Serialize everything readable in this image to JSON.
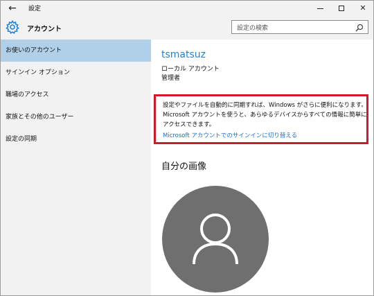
{
  "titlebar": {
    "back_icon": "arrow-left-icon",
    "title": "設定",
    "minimize_icon": "minimize-icon",
    "maximize_icon": "maximize-icon",
    "close_glyph": "✕"
  },
  "header": {
    "icon": "gear-icon",
    "title": "アカウント",
    "search_placeholder": "設定の検索",
    "search_icon": "search-icon"
  },
  "sidebar": {
    "items": [
      {
        "label": "お使いのアカウント",
        "active": true
      },
      {
        "label": "サインイン オプション",
        "active": false
      },
      {
        "label": "職場のアクセス",
        "active": false
      },
      {
        "label": "家族とその他のユーザー",
        "active": false
      },
      {
        "label": "設定の同期",
        "active": false
      }
    ]
  },
  "account": {
    "username": "tsmatsuz",
    "type": "ローカル アカウント",
    "role": "管理者"
  },
  "notice": {
    "text": "設定やファイルを自動的に同期すれば、Windows がさらに便利になります。Microsoft アカウントを使うと、あらゆるデバイスからすべての情報に簡単にアクセスできます。",
    "link": "Microsoft アカウントでのサインインに切り替える",
    "highlight_color": "#d0192a"
  },
  "picture": {
    "title": "自分の画像",
    "avatar_icon": "person-icon"
  },
  "colors": {
    "accent": "#1e82d7",
    "sidebar_active": "#b0cfe8",
    "chrome": "#f2f2f2",
    "avatar_bg": "#6f6f6f"
  }
}
